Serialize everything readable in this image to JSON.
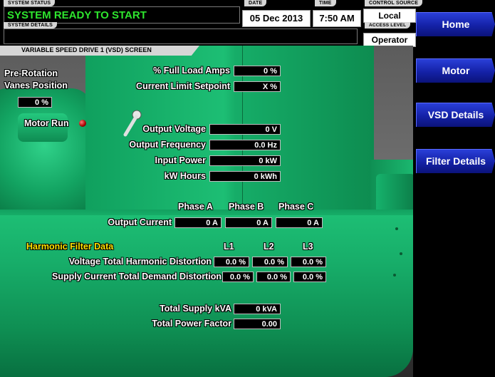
{
  "header": {
    "system_status_label": "SYSTEM STATUS",
    "system_status": "SYSTEM READY TO START",
    "system_details_label": "SYSTEM DETAILS",
    "date_label": "DATE",
    "date": "05 Dec 2013",
    "time_label": "TIME",
    "time": "7:50 AM",
    "control_source_label": "CONTROL SOURCE",
    "control_source": "Local",
    "access_level_label": "ACCESS LEVEL",
    "access_level": "Operator"
  },
  "nav": {
    "home": "Home",
    "motor": "Motor",
    "vsd_details": "VSD Details",
    "filter_details": "Filter Details"
  },
  "screen_title": "VARIABLE SPEED DRIVE 1 (VSD) SCREEN",
  "pre_rotation": {
    "label_line1": "Pre-Rotation",
    "label_line2": "Vanes Position",
    "value": "0 %"
  },
  "motor_run_label": "Motor Run",
  "readings": {
    "full_load_amps_label": "% Full Load Amps",
    "full_load_amps": "0 %",
    "current_limit_label": "Current Limit Setpoint",
    "current_limit": "X %",
    "output_voltage_label": "Output Voltage",
    "output_voltage": "0 V",
    "output_frequency_label": "Output Frequency",
    "output_frequency": "0.0 Hz",
    "input_power_label": "Input Power",
    "input_power": "0 kW",
    "kw_hours_label": "kW Hours",
    "kw_hours": "0 kWh"
  },
  "phases": {
    "headers": [
      "Phase A",
      "Phase B",
      "Phase C"
    ],
    "output_current_label": "Output Current",
    "output_current": [
      "0 A",
      "0 A",
      "0 A"
    ]
  },
  "harmonic": {
    "title": "Harmonic Filter Data",
    "headers": [
      "L1",
      "L2",
      "L3"
    ],
    "vthd_label": "Voltage Total Harmonic Distortion",
    "vthd": [
      "0.0 %",
      "0.0 %",
      "0.0 %"
    ],
    "sctdd_label": "Supply Current Total Demand Distortion",
    "sctdd": [
      "0.0 %",
      "0.0 %",
      "0.0 %"
    ]
  },
  "totals": {
    "supply_kva_label": "Total Supply kVA",
    "supply_kva": "0 kVA",
    "power_factor_label": "Total Power Factor",
    "power_factor": "0.00"
  },
  "colors": {
    "status_green": "#2ee52e",
    "nav_blue": "#1a2ac0",
    "machine_green": "#17b06a",
    "harmonic_title": "#ffe400",
    "motor_run_lamp": "#c00000"
  }
}
